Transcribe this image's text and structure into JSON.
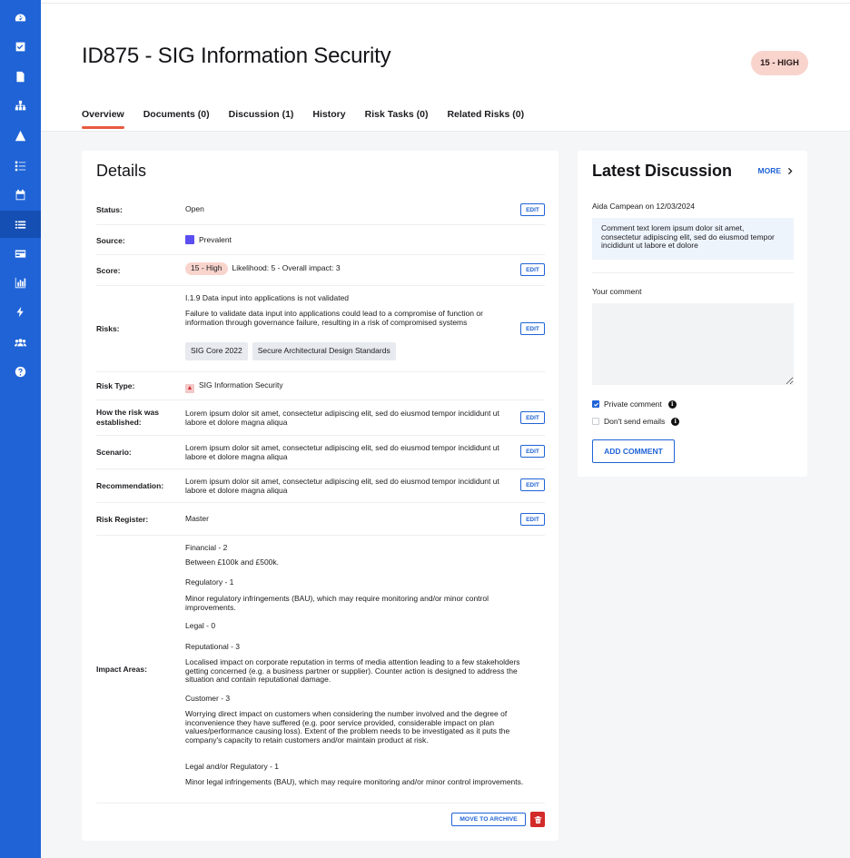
{
  "page": {
    "title": "ID875 - SIG Information Security",
    "score_badge": "15 - HIGH"
  },
  "tabs": [
    {
      "label": "Overview",
      "active": true
    },
    {
      "label": "Documents (0)"
    },
    {
      "label": "Discussion (1)"
    },
    {
      "label": "History"
    },
    {
      "label": "Risk Tasks (0)"
    },
    {
      "label": "Related Risks (0)"
    }
  ],
  "sidebar": {
    "icons": [
      "dashboard-icon",
      "tasks-check-icon",
      "document-icon",
      "org-chart-icon",
      "warning-icon",
      "checklist-icon",
      "calendar-icon",
      "list-icon",
      "card-icon",
      "bar-chart-icon",
      "lightning-icon",
      "users-icon",
      "help-icon"
    ],
    "active_index": 7
  },
  "details": {
    "title": "Details",
    "edit_label": "EDIT",
    "status": {
      "label": "Status:",
      "value": "Open"
    },
    "source": {
      "label": "Source:",
      "value": "Prevalent",
      "color": "#5b4ef0"
    },
    "score": {
      "label": "Score:",
      "pill": "15 - High",
      "text": "Likelihood: 5 - Overall impact: 3"
    },
    "risks": {
      "label": "Risks:",
      "code": "I.1.9 Data input into applications is not validated",
      "description": "Failure to validate data input into applications could lead to a compromise of function or information through governance failure, resulting in a risk of compromised systems",
      "tags": [
        "SIG Core 2022",
        "Secure Architectural Design Standards"
      ]
    },
    "risk_type": {
      "label": "Risk Type:",
      "value": "SIG Information Security"
    },
    "established": {
      "label": "How the risk was established:",
      "value": "Lorem ipsum dolor sit amet, consectetur adipiscing elit, sed do eiusmod tempor incididunt ut labore et dolore magna aliqua"
    },
    "scenario": {
      "label": "Scenario:",
      "value": "Lorem ipsum dolor sit amet, consectetur adipiscing elit, sed do eiusmod tempor incididunt ut labore et dolore magna aliqua"
    },
    "recommendation": {
      "label": "Recommendation:",
      "value": "Lorem ipsum dolor sit amet, consectetur adipiscing elit, sed do eiusmod tempor incididunt ut labore et dolore magna aliqua"
    },
    "risk_register": {
      "label": "Risk Register:",
      "value": "Master"
    },
    "impact_areas": {
      "label": "Impact Areas:",
      "items": [
        {
          "heading": "Financial - 2",
          "text": "Between £100k and £500k."
        },
        {
          "heading": "Regulatory - 1",
          "text": "Minor regulatory infringements (BAU), which may require monitoring and/or minor control improvements."
        },
        {
          "heading": "Legal - 0",
          "text": ""
        },
        {
          "heading": "Reputational - 3",
          "text": "Localised impact on corporate reputation in terms of media attention leading to a few stakeholders getting concerned (e.g. a business partner or supplier). Counter action is designed to address the situation and contain reputational damage."
        },
        {
          "heading": "Customer - 3",
          "text": "Worrying direct impact on customers when considering the number involved and the degree of inconvenience they have suffered (e.g. poor service provided, considerable impact on plan values/performance causing loss). Extent of the problem needs to be investigated as it puts the company's capacity to retain customers and/or maintain product at risk."
        },
        {
          "heading": "Legal and/or Regulatory - 1",
          "text": "Minor legal infringements (BAU), which may require monitoring and/or minor control improvements."
        }
      ]
    },
    "archive_label": "MOVE TO ARCHIVE"
  },
  "discussion": {
    "title": "Latest Discussion",
    "more_label": "MORE",
    "author_line": "Aida Campean on 12/03/2024",
    "comment": "Comment text lorem ipsum dolor sit amet, consectetur adipiscing elit, sed do eiusmod tempor incididunt ut labore et dolore",
    "your_comment_label": "Your comment",
    "private_label": "Private comment",
    "private_checked": true,
    "no_email_label": "Don't send emails",
    "no_email_checked": false,
    "add_label": "ADD COMMENT"
  }
}
